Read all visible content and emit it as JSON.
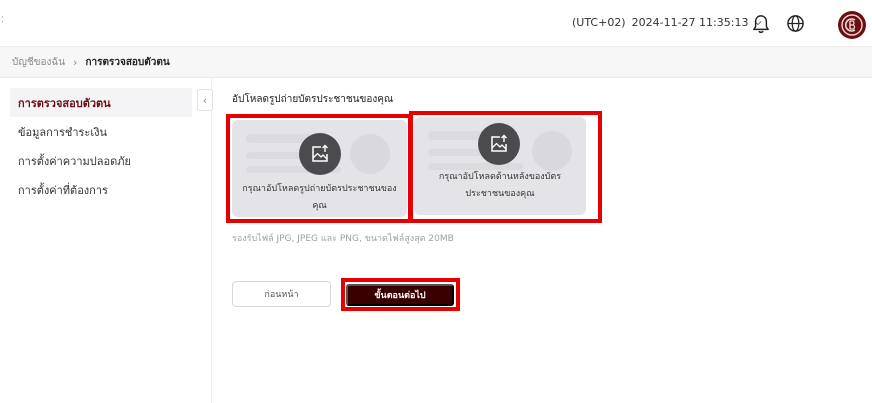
{
  "header": {
    "timezone": "(UTC+02)",
    "datetime": "2024-11-27 11:35:13",
    "accent_color": "#6b0f12"
  },
  "breadcrumb": {
    "parent": "บัญชีของฉัน",
    "current": "การตรวจสอบตัวตน"
  },
  "sidebar": {
    "items": [
      {
        "label": "การตรวจสอบตัวตน",
        "active": true
      },
      {
        "label": "ข้อมูลการชำระเงิน",
        "active": false
      },
      {
        "label": "การตั้งค่าความปลอดภัย",
        "active": false
      },
      {
        "label": "การตั้งค่าที่ต้องการ",
        "active": false
      }
    ]
  },
  "main": {
    "section_title": "อัปโหลดรูปถ่ายบัตรประชาชนของคุณ",
    "front_card_label": "กรุณาอัปโหลดรูปถ่ายบัตรประชาชนของคุณ",
    "back_card_label": "กรุณาอัปโหลดด้านหลังของบัตรประชาชนของคุณ",
    "file_hint": "รองรับไฟล์ JPG, JPEG และ PNG, ขนาดไฟล์สูงสุด 20MB",
    "back_button": "ก่อนหน้า",
    "next_button": "ขั้นตอนต่อไป"
  },
  "highlight_color": "#e60000"
}
